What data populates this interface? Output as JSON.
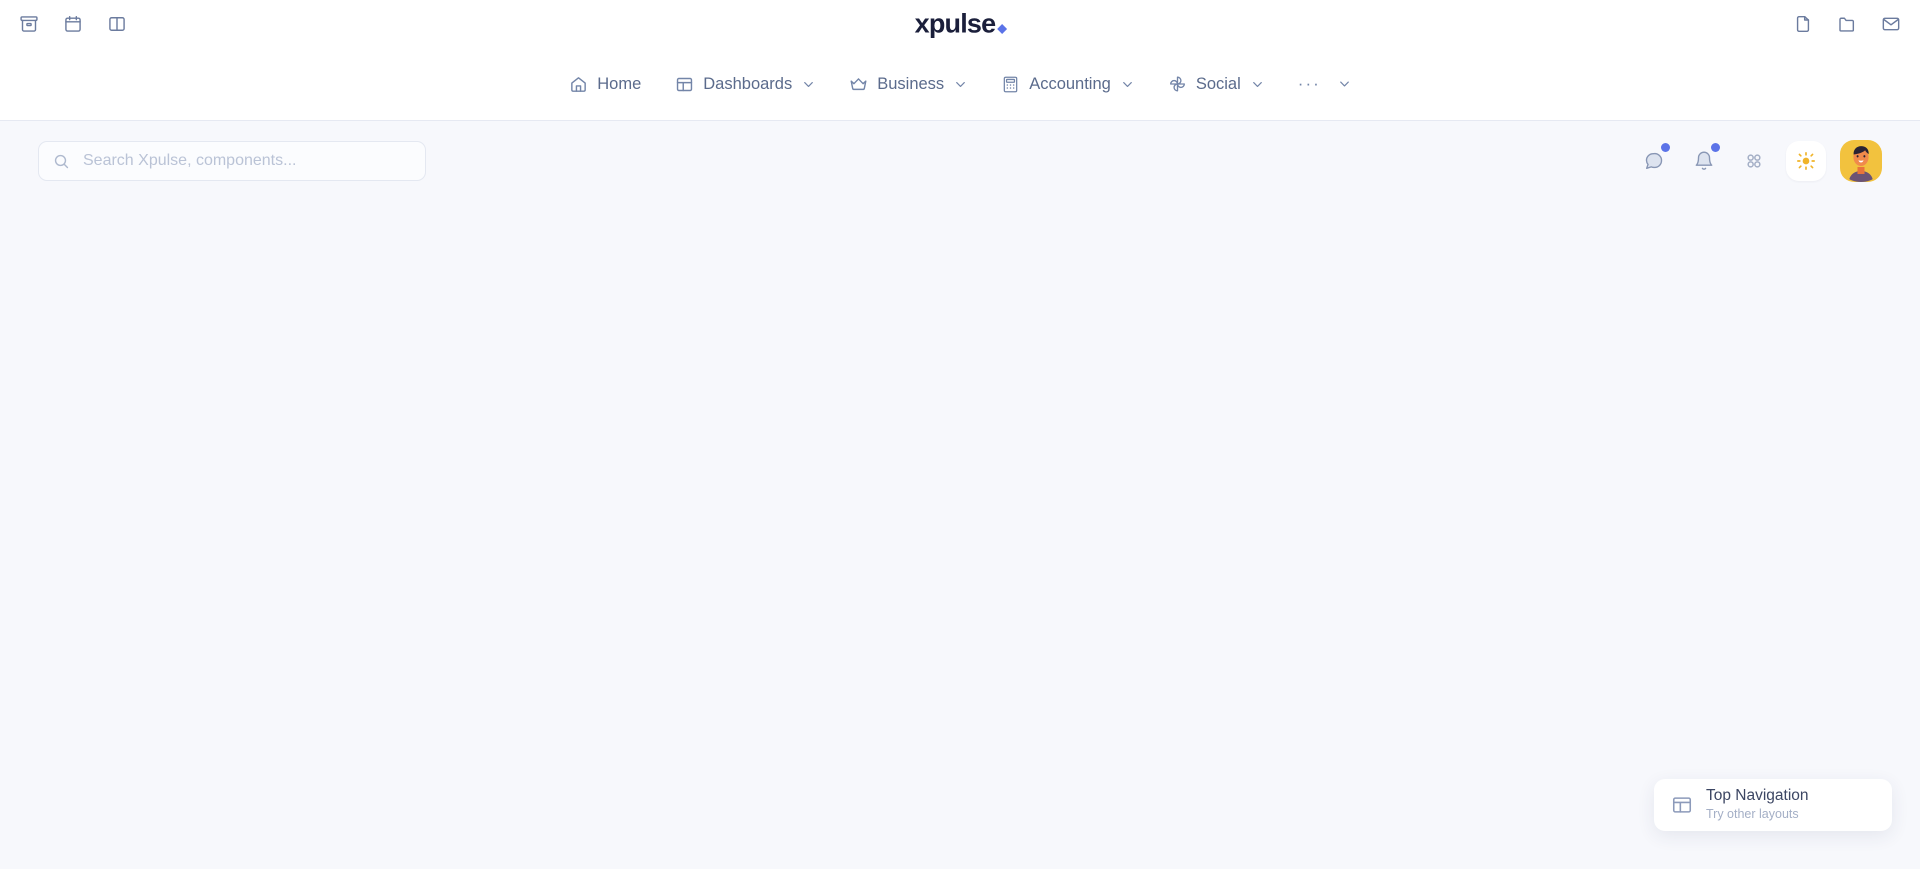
{
  "topbar": {
    "left_icons": [
      {
        "name": "archive-icon",
        "label": "Archive"
      },
      {
        "name": "calendar-icon",
        "label": "Calendar"
      },
      {
        "name": "panel-layout-icon",
        "label": "Panel Layout"
      }
    ],
    "right_icons": [
      {
        "name": "file-icon",
        "label": "File"
      },
      {
        "name": "folder-icon",
        "label": "Folder"
      },
      {
        "name": "mail-icon",
        "label": "Mail"
      }
    ],
    "brand": {
      "x": "x",
      "rest": "pulse",
      "full": "xpulse.",
      "accent_color": "#5B73E8",
      "text_color": "#1B1F3B"
    }
  },
  "nav": {
    "items": [
      {
        "label": "Home",
        "icon": "home-icon",
        "has_chevron": false
      },
      {
        "label": "Dashboards",
        "icon": "dashboard-layout-icon",
        "has_chevron": true
      },
      {
        "label": "Business",
        "icon": "crown-icon",
        "has_chevron": true
      },
      {
        "label": "Accounting",
        "icon": "calculator-icon",
        "has_chevron": true
      },
      {
        "label": "Social",
        "icon": "pinwheel-icon",
        "has_chevron": true
      }
    ],
    "overflow": {
      "label": "···",
      "icon": "more-dots-icon",
      "has_chevron": true
    }
  },
  "search": {
    "placeholder": "Search Xpulse, components...",
    "value": "",
    "icon": "search-icon"
  },
  "actions": [
    {
      "name": "chat-icon",
      "label": "Chat",
      "badge": true
    },
    {
      "name": "bell-icon",
      "label": "Notifications",
      "badge": true
    },
    {
      "name": "apps-grid-icon",
      "label": "Apps",
      "badge": false
    }
  ],
  "theme_toggle": {
    "name": "sun-icon",
    "label": "Light mode",
    "color": "#F0B429"
  },
  "avatar": {
    "name": "avatar",
    "label": "User profile",
    "background": "#F2C23E"
  },
  "layout_card": {
    "title": "Top Navigation",
    "subtitle": "Try other layouts",
    "icon": "layout-icon"
  },
  "colors": {
    "page_background": "#F7F8FC",
    "header_background": "#FFFFFF",
    "accent": "#5B73E8",
    "text_muted": "#5B6B8C",
    "border": "#E6E9F2"
  }
}
